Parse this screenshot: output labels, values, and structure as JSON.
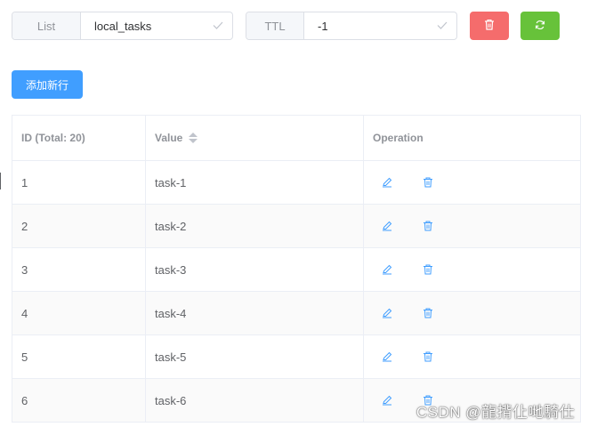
{
  "list_field": {
    "label": "List",
    "value": "local_tasks"
  },
  "ttl_field": {
    "label": "TTL",
    "value": "-1"
  },
  "actions": {
    "delete_icon": "trash-icon",
    "refresh_icon": "refresh-icon",
    "add_row_label": "添加新行"
  },
  "colors": {
    "danger": "#f56c6c",
    "success": "#67c23a",
    "primary": "#409eff"
  },
  "table": {
    "columns": [
      "ID (Total: 20)",
      "Value",
      "Operation"
    ],
    "rows": [
      {
        "id": "1",
        "value": "task-1"
      },
      {
        "id": "2",
        "value": "task-2"
      },
      {
        "id": "3",
        "value": "task-3"
      },
      {
        "id": "4",
        "value": "task-4"
      },
      {
        "id": "5",
        "value": "task-5"
      },
      {
        "id": "6",
        "value": "task-6"
      }
    ]
  },
  "watermark": "CSDN @龍揹仩哋騎仕"
}
